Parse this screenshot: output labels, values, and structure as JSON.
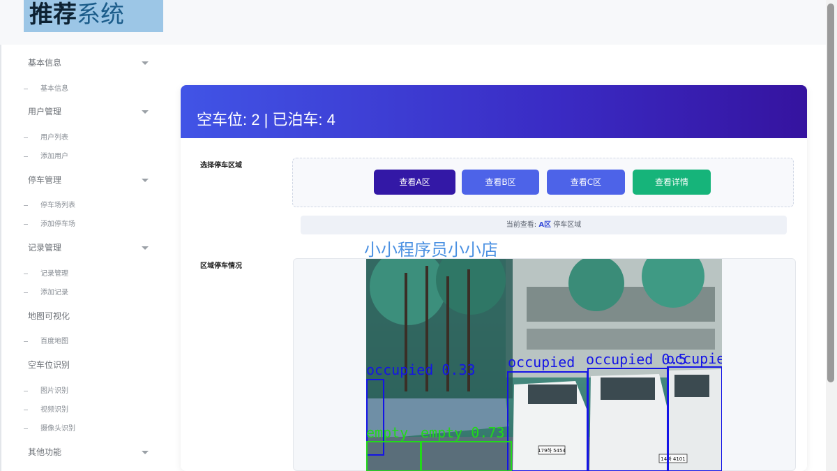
{
  "logo": {
    "part1": "推荐",
    "part2": "系统"
  },
  "sidebar": {
    "groups": [
      {
        "label": "基本信息",
        "arrow": true,
        "items": [
          "基本信息"
        ]
      },
      {
        "label": "用户管理",
        "arrow": true,
        "items": [
          "用户列表",
          "添加用户"
        ]
      },
      {
        "label": "停车管理",
        "arrow": true,
        "items": [
          "停车场列表",
          "添加停车场"
        ]
      },
      {
        "label": "记录管理",
        "arrow": true,
        "items": [
          "记录管理",
          "添加记录"
        ]
      },
      {
        "label": "地图可视化",
        "arrow": false,
        "items": [
          "百度地图"
        ]
      },
      {
        "label": "空车位识别",
        "arrow": false,
        "items": [
          "图片识别",
          "视频识别",
          "摄像头识别"
        ]
      },
      {
        "label": "其他功能",
        "arrow": true,
        "items": []
      }
    ]
  },
  "card": {
    "title": "空车位: 2 | 已泊车: 4",
    "select_label": "选择停车区域",
    "status_label": "区域停车情况",
    "buttons": [
      {
        "label": "查看A区",
        "color": "#3318a6"
      },
      {
        "label": "查看B区",
        "color": "#4d63e8"
      },
      {
        "label": "查看C区",
        "color": "#4d63e8"
      },
      {
        "label": "查看详情",
        "color": "#16b47a"
      }
    ],
    "current_prefix": "当前查看:",
    "current_area": "A区",
    "current_suffix": "停车区域",
    "watermark": "小小程序员小小店"
  },
  "detections": [
    {
      "label": "occupied 0.33",
      "color": "#1414e6"
    },
    {
      "label": "occupied",
      "color": "#1414e6"
    },
    {
      "label": "occupied 0.5",
      "color": "#1414e6"
    },
    {
      "label": "occupied",
      "color": "#1414e6"
    },
    {
      "label": "empty",
      "color": "#22d81a"
    },
    {
      "label": "empty 0.73",
      "color": "#22d81a"
    }
  ],
  "plates": [
    "179하 5454",
    "14마 4101"
  ],
  "colors": {
    "header_start": "#4154e6",
    "header_end": "#35139f",
    "accent": "#3a4fd9",
    "occupied_box": "#1414e6",
    "empty_box": "#22d81a"
  }
}
